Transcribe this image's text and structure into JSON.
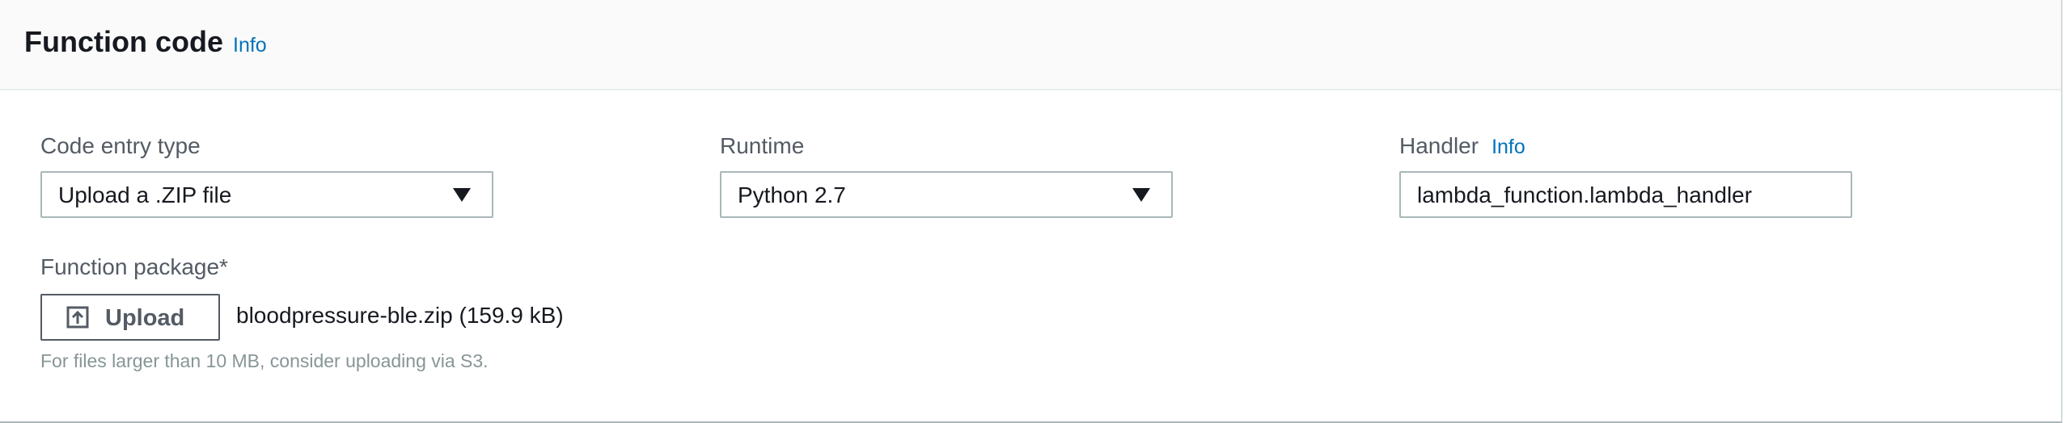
{
  "section": {
    "title": "Function code",
    "info_link": "Info"
  },
  "code_entry_type": {
    "label": "Code entry type",
    "selected": "Upload a .ZIP file"
  },
  "runtime": {
    "label": "Runtime",
    "selected": "Python 2.7"
  },
  "handler": {
    "label": "Handler",
    "info_link": "Info",
    "value": "lambda_function.lambda_handler"
  },
  "function_package": {
    "label": "Function package*",
    "upload_label": "Upload",
    "file_name": "bloodpressure-ble.zip (159.9 kB)",
    "hint": "For files larger than 10 MB, consider uploading via S3."
  },
  "icons": {
    "upload": "upload-icon",
    "dropdown": "caret-down-icon"
  },
  "colors": {
    "link": "#0073bb",
    "text": "#16191f",
    "label": "#545b64",
    "hint": "#879596",
    "border": "#aab7b8",
    "header_bg": "#fafafa"
  }
}
